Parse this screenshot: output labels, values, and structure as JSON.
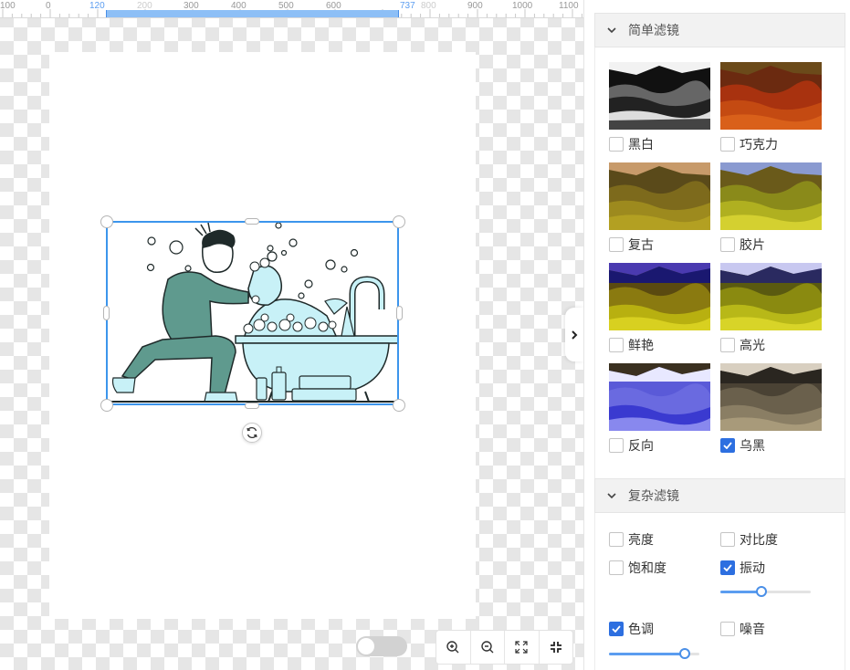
{
  "ruler": {
    "labels": [
      "100",
      "0",
      "120",
      "200",
      "300",
      "400",
      "500",
      "600",
      "737",
      "800",
      "900",
      "1000",
      "1100"
    ],
    "selection_start": "120",
    "selection_end": "737"
  },
  "canvas": {
    "icons": {
      "rotate": "rotate-icon",
      "collapse": "chevron-right-icon"
    }
  },
  "toolbar": {
    "toggle_on": false,
    "zoom_in_icon": "zoom-in-icon",
    "zoom_out_icon": "zoom-out-icon",
    "fit_icon": "expand-icon",
    "actual_icon": "compress-icon"
  },
  "panel": {
    "simple": {
      "title": "简单滤镜",
      "filters": [
        {
          "label": "黑白",
          "checked": false
        },
        {
          "label": "巧克力",
          "checked": false
        },
        {
          "label": "复古",
          "checked": false
        },
        {
          "label": "胶片",
          "checked": false
        },
        {
          "label": "鲜艳",
          "checked": false
        },
        {
          "label": "高光",
          "checked": false
        },
        {
          "label": "反向",
          "checked": false
        },
        {
          "label": "乌黑",
          "checked": true
        }
      ]
    },
    "complex": {
      "title": "复杂滤镜",
      "options": [
        {
          "label": "亮度",
          "checked": false
        },
        {
          "label": "对比度",
          "checked": false
        },
        {
          "label": "饱和度",
          "checked": false
        },
        {
          "label": "振动",
          "checked": true,
          "level": 0.45
        },
        {
          "label": "色调",
          "checked": true,
          "level": 0.88
        },
        {
          "label": "噪音",
          "checked": false
        }
      ]
    }
  },
  "colors": {
    "accent": "#2d6fe0",
    "selection": "#3c95ec",
    "illustration_fill": "#c8f1f7",
    "illustration_dark": "#5f9a8e"
  }
}
